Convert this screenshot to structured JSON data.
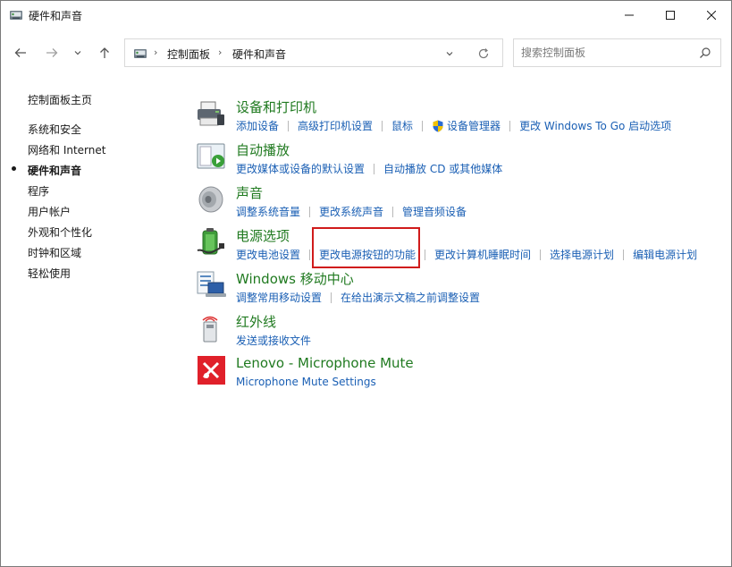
{
  "window": {
    "title": "硬件和声音"
  },
  "address": {
    "crumbs": [
      "控制面板",
      "硬件和声音"
    ]
  },
  "search": {
    "placeholder": "搜索控制面板"
  },
  "sidebar": {
    "items": [
      {
        "label": "控制面板主页",
        "current": false
      },
      {
        "label": "系统和安全",
        "current": false
      },
      {
        "label": "网络和 Internet",
        "current": false
      },
      {
        "label": "硬件和声音",
        "current": true
      },
      {
        "label": "程序",
        "current": false
      },
      {
        "label": "用户帐户",
        "current": false
      },
      {
        "label": "外观和个性化",
        "current": false
      },
      {
        "label": "时钟和区域",
        "current": false
      },
      {
        "label": "轻松使用",
        "current": false
      }
    ]
  },
  "categories": [
    {
      "title": "设备和打印机",
      "icon": "printer-icon",
      "links": [
        "添加设备",
        "高级打印机设置",
        "鼠标",
        "设备管理器",
        "更改 Windows To Go 启动选项"
      ]
    },
    {
      "title": "自动播放",
      "icon": "autoplay-icon",
      "links": [
        "更改媒体或设备的默认设置",
        "自动播放 CD 或其他媒体"
      ]
    },
    {
      "title": "声音",
      "icon": "speaker-icon",
      "links": [
        "调整系统音量",
        "更改系统声音",
        "管理音频设备"
      ]
    },
    {
      "title": "电源选项",
      "icon": "battery-plug-icon",
      "links": [
        "更改电池设置",
        "更改电源按钮的功能",
        "更改计算机睡眠时间",
        "选择电源计划",
        "编辑电源计划"
      ]
    },
    {
      "title": "Windows 移动中心",
      "icon": "mobility-center-icon",
      "links": [
        "调整常用移动设置",
        "在给出演示文稿之前调整设置"
      ]
    },
    {
      "title": "红外线",
      "icon": "infrared-icon",
      "links": [
        "发送或接收文件"
      ]
    },
    {
      "title": "Lenovo - Microphone Mute",
      "icon": "lenovo-mic-mute-icon",
      "links": [
        "Microphone Mute Settings"
      ]
    }
  ],
  "colors": {
    "category_title": "#207a20",
    "link": "#1a5fb4",
    "highlight": "#d01b1b",
    "shield_blue": "#2b6cd1",
    "shield_yellow": "#f2c200"
  }
}
